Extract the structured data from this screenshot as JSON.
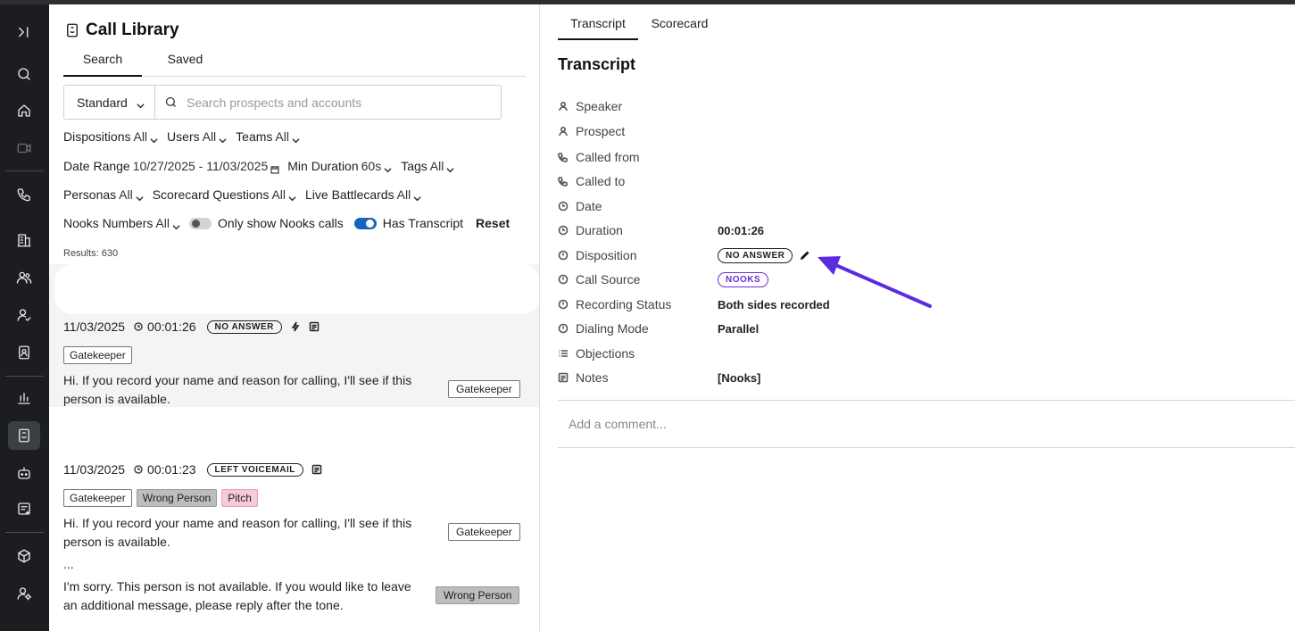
{
  "nav": {
    "items": [
      {
        "name": "collapse-sidebar-icon"
      },
      {
        "name": "search-icon"
      },
      {
        "name": "home-icon"
      },
      {
        "name": "video-icon"
      },
      {
        "name": "phone-icon"
      },
      {
        "name": "accounts-building-icon"
      },
      {
        "name": "users-icon"
      },
      {
        "name": "user-check-icon"
      },
      {
        "name": "contacts-book-icon"
      },
      {
        "name": "bar-chart-icon"
      },
      {
        "name": "call-library-icon"
      },
      {
        "name": "bot-icon"
      },
      {
        "name": "list-add-icon"
      },
      {
        "name": "cube-icon"
      },
      {
        "name": "user-settings-icon"
      }
    ]
  },
  "library": {
    "title": "Call Library",
    "tabs": [
      "Search",
      "Saved"
    ],
    "mode": "Standard",
    "search_placeholder": "Search prospects and accounts",
    "filters": {
      "dispositions": {
        "label": "Dispositions",
        "value": "All"
      },
      "users": {
        "label": "Users",
        "value": "All"
      },
      "teams": {
        "label": "Teams",
        "value": "All"
      },
      "date_range": {
        "label": "Date Range",
        "value": "10/27/2025 - 11/03/2025"
      },
      "min_duration": {
        "label": "Min Duration",
        "value": "60s"
      },
      "tags": {
        "label": "Tags",
        "value": "All"
      },
      "personas": {
        "label": "Personas",
        "value": "All"
      },
      "scorecard_questions": {
        "label": "Scorecard Questions",
        "value": "All"
      },
      "live_battlecards": {
        "label": "Live Battlecards",
        "value": "All"
      },
      "nooks_numbers": {
        "label": "Nooks Numbers",
        "value": "All"
      }
    },
    "toggles": {
      "only_nooks": {
        "label": "Only show Nooks calls",
        "on": false
      },
      "has_transcript": {
        "label": "Has Transcript",
        "on": true
      }
    },
    "reset_label": "Reset",
    "results": "Results: 630",
    "calls": [
      {
        "date": "11/03/2025",
        "duration": "00:01:26",
        "disposition": "NO ANSWER",
        "tags": [
          "Gatekeeper"
        ],
        "snippets": [
          {
            "text": "Hi. If you record your name and reason for calling, I'll see if this person is available.",
            "tag": "Gatekeeper"
          }
        ]
      },
      {
        "date": "11/03/2025",
        "duration": "00:01:23",
        "disposition": "LEFT VOICEMAIL",
        "tags": [
          "Gatekeeper",
          "Wrong Person",
          "Pitch"
        ],
        "snippets": [
          {
            "text": "Hi. If you record your name and reason for calling, I'll see if this person is available.",
            "tag": "Gatekeeper"
          },
          {
            "text": "...",
            "tag": ""
          },
          {
            "text": "I'm sorry. This person is not available. If you would like to leave an additional message, please reply after the tone.",
            "tag": "Wrong Person"
          }
        ]
      }
    ]
  },
  "detail": {
    "tabs": [
      "Transcript",
      "Scorecard"
    ],
    "title": "Transcript",
    "fields": {
      "speaker": {
        "label": "Speaker",
        "value": ""
      },
      "prospect": {
        "label": "Prospect",
        "value": ""
      },
      "called_from": {
        "label": "Called from",
        "value": ""
      },
      "called_to": {
        "label": "Called to",
        "value": ""
      },
      "date": {
        "label": "Date",
        "value": ""
      },
      "duration": {
        "label": "Duration",
        "value": "00:01:26"
      },
      "disposition": {
        "label": "Disposition",
        "value": "NO ANSWER"
      },
      "call_source": {
        "label": "Call Source",
        "value": "NOOKS"
      },
      "recording_status": {
        "label": "Recording Status",
        "value": "Both sides recorded"
      },
      "dialing_mode": {
        "label": "Dialing Mode",
        "value": "Parallel"
      },
      "objections": {
        "label": "Objections",
        "value": ""
      },
      "notes": {
        "label": "Notes",
        "value": "[Nooks]"
      }
    },
    "comment_placeholder": "Add a comment..."
  },
  "colors": {
    "rail_bg": "#1c1d21",
    "toggle_on": "#1565c0",
    "nooks_purple": "#6a2fd1",
    "arrow": "#5b2be0"
  }
}
